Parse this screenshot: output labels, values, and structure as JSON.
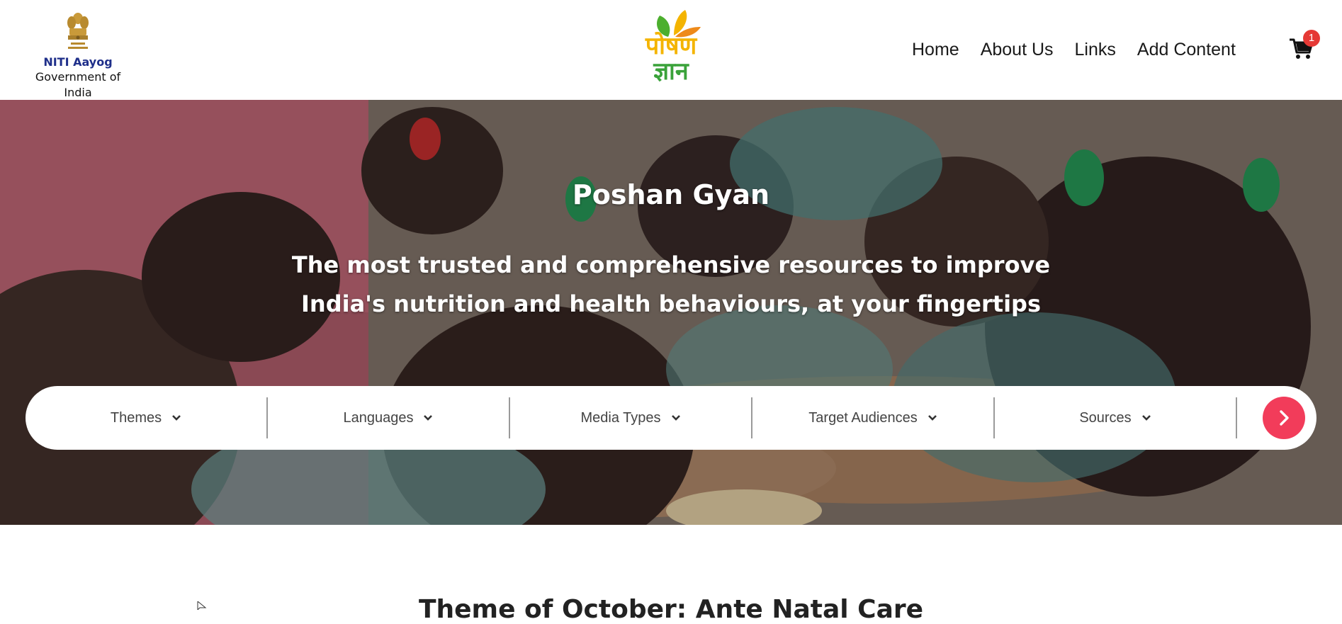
{
  "header": {
    "niti": {
      "name": "NITI Aayog",
      "gov": "Government of India",
      "emblem_icon": "state-emblem-icon"
    },
    "logo": {
      "line1": "पोषण",
      "line2": "ज्ञान",
      "leaf_icon": "leaves-icon",
      "colors": {
        "orange": "#f4b400",
        "green": "#3aa23a"
      }
    },
    "nav": [
      {
        "label": "Home"
      },
      {
        "label": "About Us"
      },
      {
        "label": "Links"
      },
      {
        "label": "Add Content"
      }
    ],
    "cart": {
      "icon": "cart-icon",
      "count": "1",
      "badge_color": "#e53935"
    }
  },
  "hero": {
    "title": "Poshan Gyan",
    "subtitle_line1": "The most trusted and comprehensive resources to improve",
    "subtitle_line2": "India's nutrition and health behaviours, at your fingertips"
  },
  "filters": {
    "items": [
      {
        "label": "Themes"
      },
      {
        "label": "Languages"
      },
      {
        "label": "Media Types"
      },
      {
        "label": "Target Audiences"
      },
      {
        "label": "Sources"
      }
    ],
    "chevron_icon": "chevron-down-icon",
    "go_icon": "chevron-right-icon",
    "go_color": "#f23c5a"
  },
  "section": {
    "title": "Theme of October: Ante Natal Care"
  }
}
